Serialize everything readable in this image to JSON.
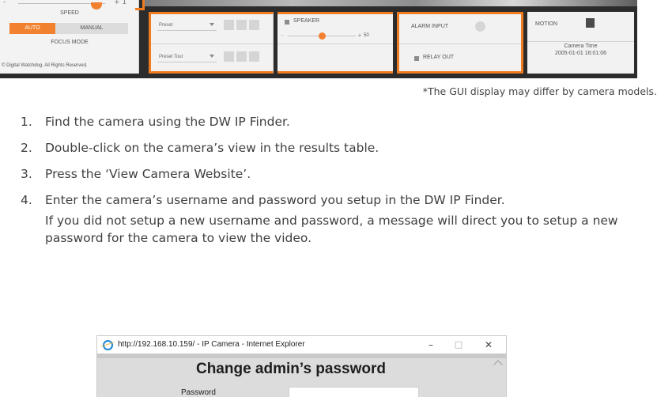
{
  "camera_gui": {
    "speed": {
      "minus": "-",
      "plus": "+ 1",
      "label": "SPEED"
    },
    "focus": {
      "auto": "AUTO",
      "manual": "MANUAL",
      "label": "FOCUS MODE"
    },
    "copyright": "© Digital Watchdog. All Rights Reserved.",
    "preset": {
      "preset_select": "Preset",
      "preset_tour_select": "Preset Tour"
    },
    "speaker": {
      "label": "SPEAKER",
      "value": "50",
      "minus": "-",
      "plus": "+"
    },
    "alarm": {
      "input_label": "ALARM INPUT",
      "relay_label": "RELAY OUT"
    },
    "motion": {
      "label": "MOTION",
      "camera_time_label": "Camera Time",
      "camera_time_value": "2005-01-01 16:01:06"
    },
    "colors": {
      "accent": "#f07c21",
      "frame": "#2c2c2c",
      "panel": "#f2f2f2"
    }
  },
  "disclaimer": "*The GUI display may differ by camera models.",
  "steps": [
    {
      "num": "1.",
      "text": "Find the camera using the DW IP Finder."
    },
    {
      "num": "2.",
      "text": "Double-click on the camera’s view in the results table."
    },
    {
      "num": "3.",
      "text": "Press the ‘View Camera Website’."
    },
    {
      "num": "4.",
      "text": "Enter the camera’s username and password you setup in the DW IP Finder.",
      "note": "If you did not setup a new username and password, a message will direct you to setup a new password for the camera to view the video."
    }
  ],
  "dialog": {
    "title": "http://192.168.10.159/ - IP Camera - Internet Explorer",
    "minimize": "–",
    "maximize": "□",
    "close": "✕",
    "heading": "Change admin’s password",
    "password_label": "Password",
    "password_value": ""
  }
}
